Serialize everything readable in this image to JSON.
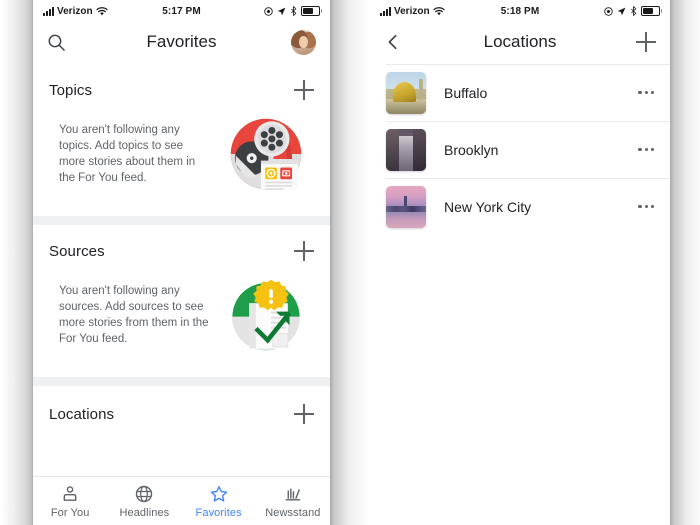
{
  "colors": {
    "accent_blue": "#4285f4",
    "text_primary": "#202124",
    "text_secondary": "#5f6368",
    "divider": "#e8eaed",
    "page_bg": "#eceff1",
    "topics_art_red": "#e8453c",
    "sources_art_green": "#1e9e4a",
    "sources_badge_yellow": "#f5c211"
  },
  "left_screen": {
    "status_bar": {
      "carrier": "Verizon",
      "time": "5:17 PM",
      "signal_icon": "signal-bars-icon",
      "wifi_icon": "wifi-icon",
      "do_not_disturb_icon": "do-not-disturb-icon",
      "location_icon": "location-arrow-icon",
      "bluetooth_icon": "bluetooth-icon",
      "battery_icon": "battery-icon"
    },
    "nav": {
      "title": "Favorites",
      "search_icon": "search-icon",
      "avatar": "profile-avatar"
    },
    "cards": [
      {
        "title": "Topics",
        "add_icon": "plus-icon",
        "empty_text": "You aren't following any topics. Add topics to see more stories about them in the For You feed.",
        "illustration": "topics-illustration"
      },
      {
        "title": "Sources",
        "add_icon": "plus-icon",
        "empty_text": "You aren't following any sources. Add sources to see more stories from them in the For You feed.",
        "illustration": "sources-illustration"
      },
      {
        "title": "Locations",
        "add_icon": "plus-icon",
        "empty_text": "",
        "illustration": ""
      }
    ],
    "tabs": [
      {
        "label": "For You",
        "icon": "person-icon",
        "active": false
      },
      {
        "label": "Headlines",
        "icon": "globe-icon",
        "active": false
      },
      {
        "label": "Favorites",
        "icon": "star-icon",
        "active": true
      },
      {
        "label": "Newsstand",
        "icon": "newsstand-icon",
        "active": false
      }
    ]
  },
  "right_screen": {
    "status_bar": {
      "carrier": "Verizon",
      "time": "5:18 PM",
      "signal_icon": "signal-bars-icon",
      "wifi_icon": "wifi-icon",
      "do_not_disturb_icon": "do-not-disturb-icon",
      "location_icon": "location-arrow-icon",
      "bluetooth_icon": "bluetooth-icon",
      "battery_icon": "battery-icon"
    },
    "nav": {
      "title": "Locations",
      "back_icon": "back-chevron-icon",
      "add_icon": "plus-icon"
    },
    "locations": [
      {
        "name": "Buffalo",
        "thumb": "buffalo-thumbnail",
        "menu_icon": "overflow-menu-icon"
      },
      {
        "name": "Brooklyn",
        "thumb": "brooklyn-thumbnail",
        "menu_icon": "overflow-menu-icon"
      },
      {
        "name": "New York City",
        "thumb": "new-york-city-thumbnail",
        "menu_icon": "overflow-menu-icon"
      }
    ]
  }
}
